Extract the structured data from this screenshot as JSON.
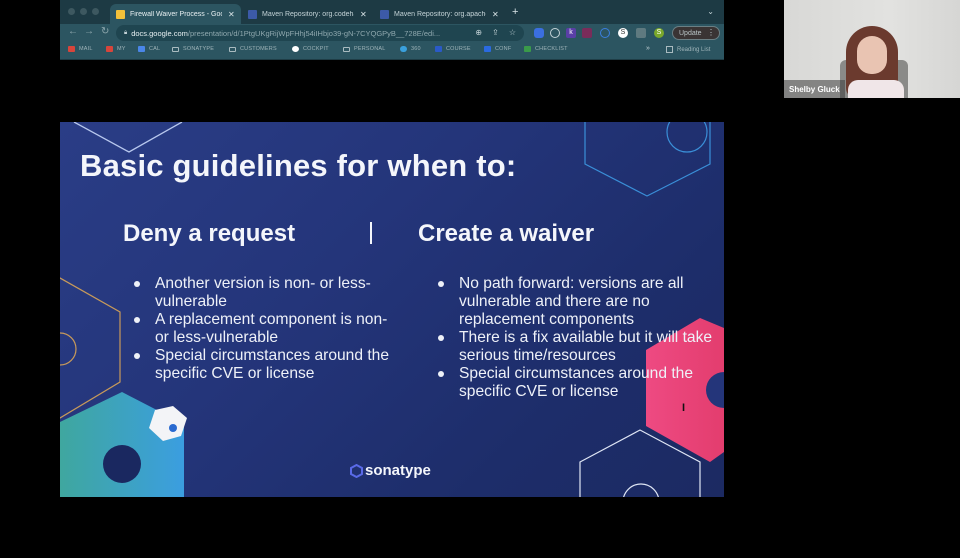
{
  "browser": {
    "tabs": [
      {
        "title": "Firewall Waiver Process - Goo",
        "favicon": "google-slides",
        "active": true
      },
      {
        "title": "Maven Repository: org.codeha",
        "favicon": "maven",
        "active": false
      },
      {
        "title": "Maven Repository: org.apache",
        "favicon": "maven",
        "active": false
      }
    ],
    "new_tab": "+",
    "tab_menu": "⌄",
    "nav": {
      "back": "←",
      "forward": "→",
      "reload": "↻"
    },
    "url_host": "docs.google.com",
    "url_path": "/presentation/d/1PtgUKgRijWpFHhj54iIHbjo39-gN-7CYQGPyB__728E/edi...",
    "omnibox_icons": [
      "zoom-icon",
      "share-icon",
      "star-icon"
    ],
    "extensions": [
      {
        "name": "bitwarden",
        "color": "#3b6fe0"
      },
      {
        "name": "refresh-ext",
        "color": "#c4d3d7"
      },
      {
        "name": "k-ext",
        "color": "#5a3fa6",
        "label": "k"
      },
      {
        "name": "m-ext",
        "color": "#7a2c5a"
      },
      {
        "name": "ring-ext",
        "color": "#3b7fe0"
      },
      {
        "name": "s-ext",
        "color": "#ffffff",
        "label": "S"
      },
      {
        "name": "puzzle-ext",
        "color": "#5f7a80"
      }
    ],
    "profile_initial": "S",
    "profile_color": "#7aa82c",
    "update_label": "Update",
    "bookmarks": [
      {
        "label": "MAIL",
        "icon": "gmail"
      },
      {
        "label": "MY",
        "icon": "gmail"
      },
      {
        "label": "CAL",
        "icon": "calendar"
      },
      {
        "label": "SONATYPE",
        "icon": "folder"
      },
      {
        "label": "CUSTOMERS",
        "icon": "folder"
      },
      {
        "label": "COCKPIT",
        "icon": "google"
      },
      {
        "label": "PERSONAL",
        "icon": "folder"
      },
      {
        "label": "360",
        "icon": "cloud"
      },
      {
        "label": "COURSE",
        "icon": "c-logo"
      },
      {
        "label": "CONF",
        "icon": "confluence"
      },
      {
        "label": "CHECKLIST",
        "icon": "checklist"
      }
    ],
    "bookmarks_more": "»",
    "reading_list": "Reading List"
  },
  "slide": {
    "title": "Basic guidelines for when to:",
    "left_heading": "Deny a request",
    "right_heading": "Create a waiver",
    "left_bullets": [
      "Another version is non- or less-vulnerable",
      "A replacement component is non- or less-vulnerable",
      "Special circumstances around the specific CVE or license"
    ],
    "right_bullets": [
      "No path forward: versions are all vulnerable and there are no replacement components",
      "There is a fix available but it will take serious time/resources",
      "Special circumstances around the specific CVE or license"
    ],
    "logo_text": "sonatype",
    "colors": {
      "background": "#24357a",
      "accent_pink": "#e94a80",
      "accent_blue": "#3aa0dc",
      "accent_gold": "#c89a5a"
    }
  },
  "video": {
    "participant_name": "Shelby Gluck"
  }
}
